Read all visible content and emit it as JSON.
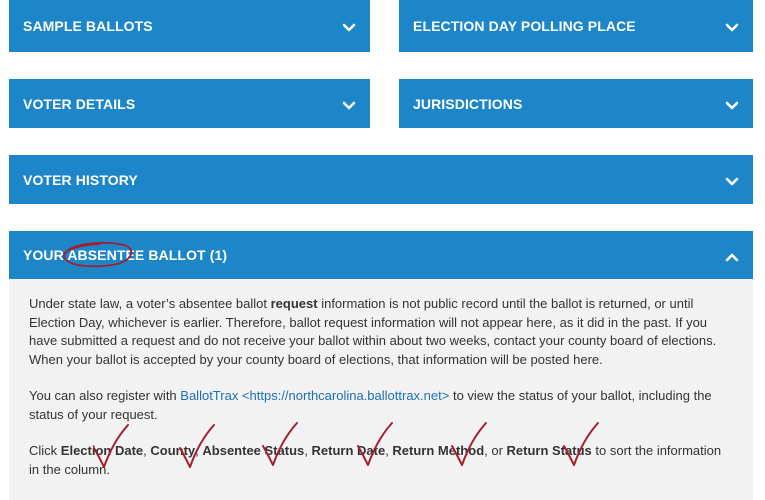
{
  "panels": {
    "sample_ballots": {
      "title": "SAMPLE BALLOTS"
    },
    "polling_place": {
      "title": "ELECTION DAY POLLING PLACE"
    },
    "voter_details": {
      "title": "VOTER DETAILS"
    },
    "jurisdictions": {
      "title": "JURISDICTIONS"
    },
    "voter_history": {
      "title": "VOTER HISTORY"
    },
    "absentee": {
      "title": "YOUR ABSENTEE BALLOT (1)"
    }
  },
  "absentee_content": {
    "para1_a": "Under state law, a voter’s absentee ballot ",
    "para1_bold": "request",
    "para1_b": " information is not public record until the ballot is returned, or until Election Day, whichever is earlier. Therefore, ballot request information will not appear here, as it did in the past. If you have submitted a request and do not receive your ballot within about two weeks, contact your county board of elections. When your ballot is accepted by your county board of elections, that information will be posted here.",
    "para2_a": "You can also register with ",
    "para2_link": "BallotTrax <https://northcarolina.ballottrax.net>",
    "para2_b": " to view the status of your ballot, including the status of your request.",
    "para3_a": "Click ",
    "col1": "Election Date",
    "sep1": ", ",
    "col2": "County",
    "sep2": ", ",
    "col3": "Absentee Status",
    "sep3": ", ",
    "col4": "Return Date",
    "sep4": ", ",
    "col5": "Return Method",
    "sep5": ", or ",
    "col6": "Return Status",
    "para3_b": " to sort the information in the column."
  },
  "colors": {
    "panel_blue": "#1d86c8",
    "annotation_red": "#a3202a",
    "content_bg": "#f2f2f2",
    "link_blue": "#1d6fb3"
  },
  "icons": {
    "collapsed": "chevron-down-icon",
    "expanded": "chevron-up-icon"
  }
}
